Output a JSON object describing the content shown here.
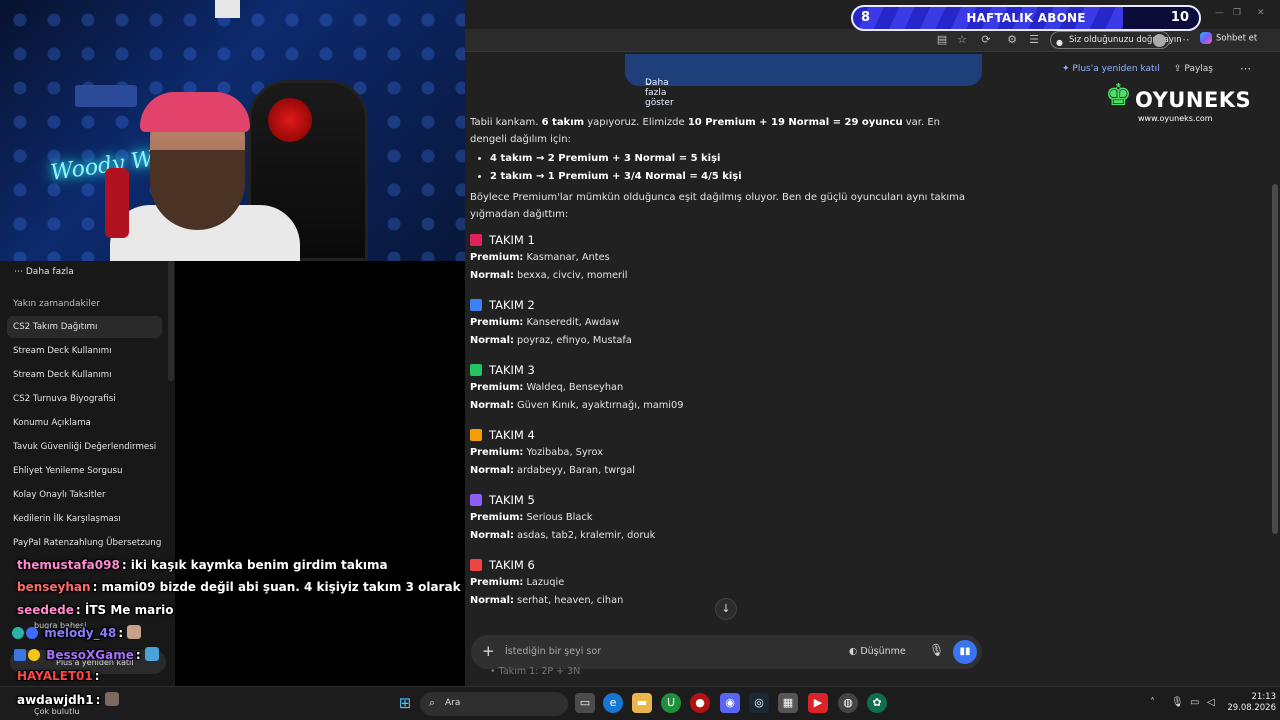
{
  "sub_bar": {
    "left_value": "8",
    "label": "HAFTALIK ABONE",
    "right_value": "10",
    "progress": 0.78
  },
  "toolbar": {
    "verify_label": "Siz olduğunuzu doğrulayın",
    "chat_label": "Sohbet et"
  },
  "sidebar": {
    "more_label": "Daha fazla",
    "section_label": "Yakın zamandakiler",
    "items": [
      "CS2 Takım Dağıtımı",
      "Stream Deck Kullanımı",
      "Stream Deck Kullanımı",
      "CS2 Turnuva Biyografisi",
      "Konumu Açıklama",
      "Tavuk Güvenliği Değerlendirmesi",
      "Ehliyet Yenileme Sorgusu",
      "Kolay Onaylı Taksitler",
      "Kedilerin İlk Karşılaşması",
      "PayPal Ratenzahlung Übersetzung"
    ],
    "active_index": 0
  },
  "header": {
    "show_more": "Daha fazla göster",
    "plus_link": "Plus'a yeniden katıl",
    "share": "Paylaş"
  },
  "watermark": {
    "brand": "OYUNEKS",
    "url": "www.oyuneks.com"
  },
  "answer": {
    "intro": {
      "p1": "Tabii kankam. ",
      "b1": "6 takım",
      "p2": " yapıyoruz. Elimizde ",
      "b2": "10 Premium + 19 Normal = 29 oyuncu",
      "p3": " var. En dengeli dağılım için:"
    },
    "dist": [
      {
        "a": "4 takım → 2 Premium + 3 Normal = 5 kişi"
      },
      {
        "a": "2 takım → 1 Premium + 3/4 Normal = 4/5 kişi"
      }
    ],
    "after": "Böylece Premium'lar mümkün olduğunca eşit dağılmış oluyor. Ben de güçlü oyuncuları aynı takıma yığmadan dağıttım:",
    "premium_key": "Premium:",
    "normal_key": "Normal:",
    "teams": [
      {
        "name": "TAKIM 1",
        "color": "#e0245e",
        "premium": "Kasmanar, Antes",
        "normal": "bexxa, civciv, momeril"
      },
      {
        "name": "TAKIM 2",
        "color": "#3b82f6",
        "premium": "Kanseredit, Awdaw",
        "normal": "poyraz, efinyo, Mustafa"
      },
      {
        "name": "TAKIM 3",
        "color": "#22c55e",
        "premium": "Waldeq, Benseyhan",
        "normal": "Güven Kınık, ayaktırnağı, mami09"
      },
      {
        "name": "TAKIM 4",
        "color": "#f59e0b",
        "premium": "Yozibaba, Syrox",
        "normal": "ardabeyy, Baran, twrgal"
      },
      {
        "name": "TAKIM 5",
        "color": "#8b5cf6",
        "premium": "Serious Black",
        "normal": "asdas, tab2, kralemir, doruk"
      },
      {
        "name": "TAKIM 6",
        "color": "#ef4444",
        "premium": "Lazuqie",
        "normal": "serhat, heaven, cihan"
      }
    ],
    "peek": "Takım 1: 2P + 3N"
  },
  "composer": {
    "placeholder": "İstediğin bir şeyi sor",
    "think_label": "Düşünme"
  },
  "stream_chat": [
    {
      "user": "themustafa098",
      "color": "#ff8ad1",
      "msg": ": iki kaşık kaymka benim girdim takıma"
    },
    {
      "user": "benseyhan",
      "color": "#ff6b6b",
      "msg": ": mami09 bizde değil abi şuan. 4 kişiyiz takım 3 olarak"
    },
    {
      "user": "seedede",
      "color": "#ff8ad1",
      "msg": ": İTS Me mario"
    },
    {
      "user": "melody_48",
      "color": "#8a7bff",
      "msg": ":"
    },
    {
      "user": "BessoXGame",
      "color": "#a970ff",
      "msg": ":"
    },
    {
      "user": "HAYALET01",
      "color": "#ff4545",
      "msg": ":"
    },
    {
      "user": "awdawjdh1",
      "color": "#ffffff",
      "msg": ":"
    }
  ],
  "chat_small": {
    "user_hint": "bugra bahesi",
    "plus_pill": "Plus'a yeniden katıl",
    "footer": "Çok bulutlu"
  },
  "taskbar": {
    "search": "Ara",
    "time": "21:13",
    "date": "29.08.2026"
  }
}
